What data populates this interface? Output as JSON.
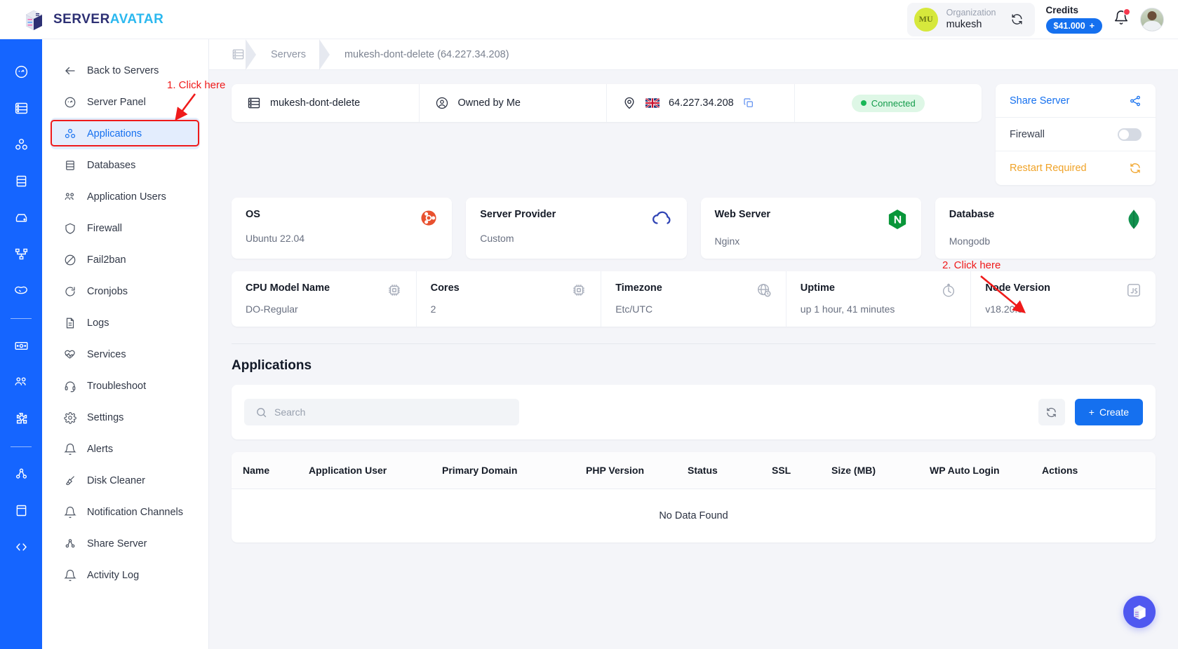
{
  "brand": {
    "part1": "SERVER",
    "part2": "AVATAR"
  },
  "topbar": {
    "org_initials": "MU",
    "org_label": "Organization",
    "org_name": "mukesh",
    "credits_label": "Credits",
    "credits_amount": "$41.000",
    "credits_plus": "+",
    "sync_icon": "sync-icon",
    "bell_icon": "notification-bell-icon",
    "avatar_icon": "user-avatar"
  },
  "rail": {
    "items": [
      {
        "icon": "dashboard-icon"
      },
      {
        "icon": "servers-icon"
      },
      {
        "icon": "applications-icon"
      },
      {
        "icon": "databases-icon"
      },
      {
        "icon": "backups-icon"
      },
      {
        "icon": "sitemap-icon"
      },
      {
        "icon": "handshake-icon"
      },
      {
        "icon": "divider"
      },
      {
        "icon": "billing-icon"
      },
      {
        "icon": "team-icon"
      },
      {
        "icon": "integrations-icon"
      },
      {
        "icon": "divider"
      },
      {
        "icon": "network-icon"
      },
      {
        "icon": "docs-icon"
      },
      {
        "icon": "code-icon"
      }
    ]
  },
  "sidebar": {
    "back_label": "Back to Servers",
    "items": [
      {
        "label": "Server Panel",
        "icon": "gauge-icon",
        "active": false
      },
      {
        "label": "Applications",
        "icon": "cubes-icon",
        "active": true
      },
      {
        "label": "Databases",
        "icon": "database-icon",
        "active": false
      },
      {
        "label": "Application Users",
        "icon": "users-icon",
        "active": false
      },
      {
        "label": "Firewall",
        "icon": "shield-icon",
        "active": false
      },
      {
        "label": "Fail2ban",
        "icon": "ban-icon",
        "active": false
      },
      {
        "label": "Cronjobs",
        "icon": "refresh-clock-icon",
        "active": false
      },
      {
        "label": "Logs",
        "icon": "document-icon",
        "active": false
      },
      {
        "label": "Services",
        "icon": "heart-pulse-icon",
        "active": false
      },
      {
        "label": "Troubleshoot",
        "icon": "headset-icon",
        "active": false
      },
      {
        "label": "Settings",
        "icon": "gear-icon",
        "active": false
      },
      {
        "label": "Alerts",
        "icon": "bell-icon",
        "active": false
      },
      {
        "label": "Disk Cleaner",
        "icon": "broom-icon",
        "active": false
      },
      {
        "label": "Notification Channels",
        "icon": "bell-icon",
        "active": false
      },
      {
        "label": "Share Server",
        "icon": "share-nodes-icon",
        "active": false
      },
      {
        "label": "Activity Log",
        "icon": "bell-icon",
        "active": false
      }
    ]
  },
  "annotations": {
    "step1": "1. Click here",
    "step2": "2. Click here"
  },
  "breadcrumb": {
    "home_icon": "server-list-icon",
    "servers": "Servers",
    "current": "mukesh-dont-delete (64.227.34.208)"
  },
  "server_strip": {
    "name": "mukesh-dont-delete",
    "name_icon": "server-icon",
    "ownership": "Owned by Me",
    "ownership_icon": "user-circle-icon",
    "location_icon": "map-pin-icon",
    "flag": "gb-flag",
    "ip": "64.227.34.208",
    "copy_icon": "copy-icon",
    "status": "Connected"
  },
  "side_panel": {
    "share_label": "Share Server",
    "share_icon": "share-icon",
    "firewall_label": "Firewall",
    "firewall_on": false,
    "restart_label": "Restart Required",
    "restart_icon": "restart-icon"
  },
  "tiles": [
    {
      "title": "OS",
      "value": "Ubuntu 22.04",
      "icon": "ubuntu-icon"
    },
    {
      "title": "Server Provider",
      "value": "Custom",
      "icon": "cloud-icon"
    },
    {
      "title": "Web Server",
      "value": "Nginx",
      "icon": "nginx-icon"
    },
    {
      "title": "Database",
      "value": "Mongodb",
      "icon": "mongodb-icon"
    }
  ],
  "specs": [
    {
      "title": "CPU Model Name",
      "value": "DO-Regular",
      "icon": "cpu-icon"
    },
    {
      "title": "Cores",
      "value": "2",
      "icon": "cpu-icon"
    },
    {
      "title": "Timezone",
      "value": "Etc/UTC",
      "icon": "globe-clock-icon"
    },
    {
      "title": "Uptime",
      "value": "up 1 hour, 41 minutes",
      "icon": "uptime-clock-icon"
    },
    {
      "title": "Node Version",
      "value": "v18.20.3",
      "icon": "javascript-icon"
    }
  ],
  "applications": {
    "section_title": "Applications",
    "search_placeholder": "Search",
    "search_value": "",
    "search_icon": "search-icon",
    "refresh_icon": "refresh-icon",
    "create_label": "Create",
    "create_plus": "+",
    "columns": [
      "Name",
      "Application User",
      "Primary Domain",
      "PHP Version",
      "Status",
      "SSL",
      "Size (MB)",
      "WP Auto Login",
      "Actions"
    ],
    "rows": [],
    "empty_message": "No Data Found"
  },
  "fab": {
    "icon": "serveravatar-cube-icon"
  },
  "colors": {
    "accent_blue": "#1570ef",
    "rail_blue": "#1565ff",
    "brand_navy": "#2d3074",
    "brand_cyan": "#2bb8ef",
    "success_green": "#18b757",
    "warning_amber": "#f0a328",
    "annotation_red": "#ef1a1a",
    "fab_purple": "#4f58f0"
  }
}
